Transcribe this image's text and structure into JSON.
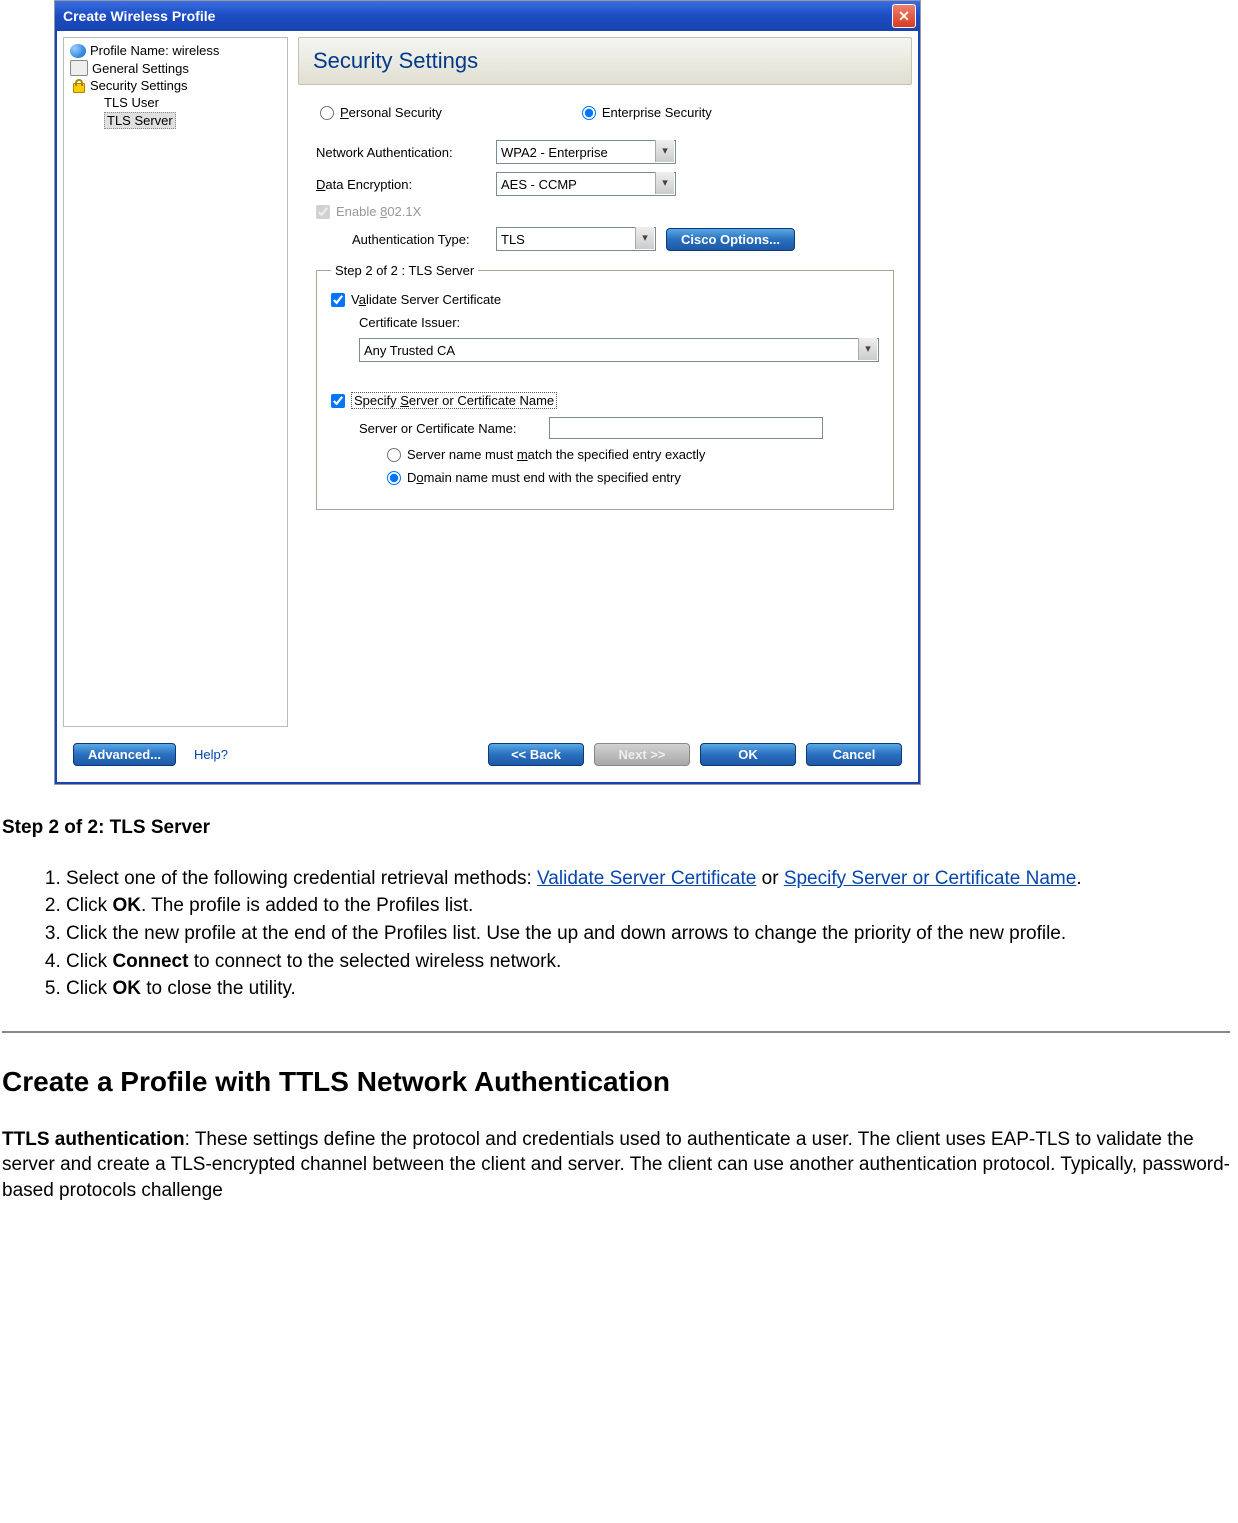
{
  "dialog": {
    "title": "Create Wireless Profile",
    "tree": {
      "items": [
        {
          "label": "Profile Name: wireless",
          "icon": "globe-icon"
        },
        {
          "label": "General Settings",
          "icon": "card-icon"
        },
        {
          "label": "Security Settings",
          "icon": "lock-icon"
        },
        {
          "label": "TLS User",
          "icon": ""
        },
        {
          "label": "TLS Server",
          "icon": "",
          "selected": true
        }
      ]
    },
    "header": "Security Settings",
    "security_type": {
      "personal": "Personal Security",
      "enterprise": "Enterprise Security",
      "selected": "enterprise"
    },
    "fields": {
      "net_auth_label": "Network Authentication:",
      "net_auth_value": "WPA2 - Enterprise",
      "data_enc_label": "Data Encryption:",
      "data_enc_value": "AES - CCMP",
      "enable_8021x_label": "Enable 802.1X",
      "auth_type_label": "Authentication Type:",
      "auth_type_value": "TLS",
      "cisco_btn": "Cisco Options..."
    },
    "step": {
      "legend": "Step 2 of 2 : TLS Server",
      "validate_cert_label": "Validate Server Certificate",
      "cert_issuer_label": "Certificate Issuer:",
      "cert_issuer_value": "Any Trusted CA",
      "specify_name_label": "Specify Server or Certificate Name",
      "server_name_label": "Server or Certificate Name:",
      "server_name_value": "",
      "match_exact_label": "Server name must match the specified entry exactly",
      "match_domain_label": "Domain name must end with the specified entry",
      "match_selected": "domain"
    },
    "buttons": {
      "advanced": "Advanced...",
      "help": "Help?",
      "back": "<< Back",
      "next": "Next >>",
      "ok": "OK",
      "cancel": "Cancel"
    }
  },
  "doc": {
    "step_title": "Step 2 of 2: TLS Server",
    "steps": {
      "s1_a": "Select one of the following credential retrieval methods: ",
      "s1_link1": "Validate Server Certificate",
      "s1_b": " or ",
      "s1_link2": "Specify Server or Certificate Name",
      "s1_c": ".",
      "s2_a": "Click ",
      "s2_bold": "OK",
      "s2_b": ". The profile is added to the Profiles list.",
      "s3": "Click the new profile at the end of the Profiles list. Use the up and down arrows to change the priority of the new profile.",
      "s4_a": "Click ",
      "s4_bold": "Connect",
      "s4_b": " to connect to the selected wireless network.",
      "s5_a": "Click ",
      "s5_bold": "OK",
      "s5_b": " to close the utility."
    },
    "h2": "Create a Profile with TTLS Network Authentication",
    "para_bold": "TTLS authentication",
    "para_rest": ": These settings define the protocol and credentials used to authenticate a user. The client uses EAP-TLS to validate the server and create a TLS-encrypted channel between the client and server. The client can use another authentication protocol. Typically, password-based protocols challenge"
  }
}
